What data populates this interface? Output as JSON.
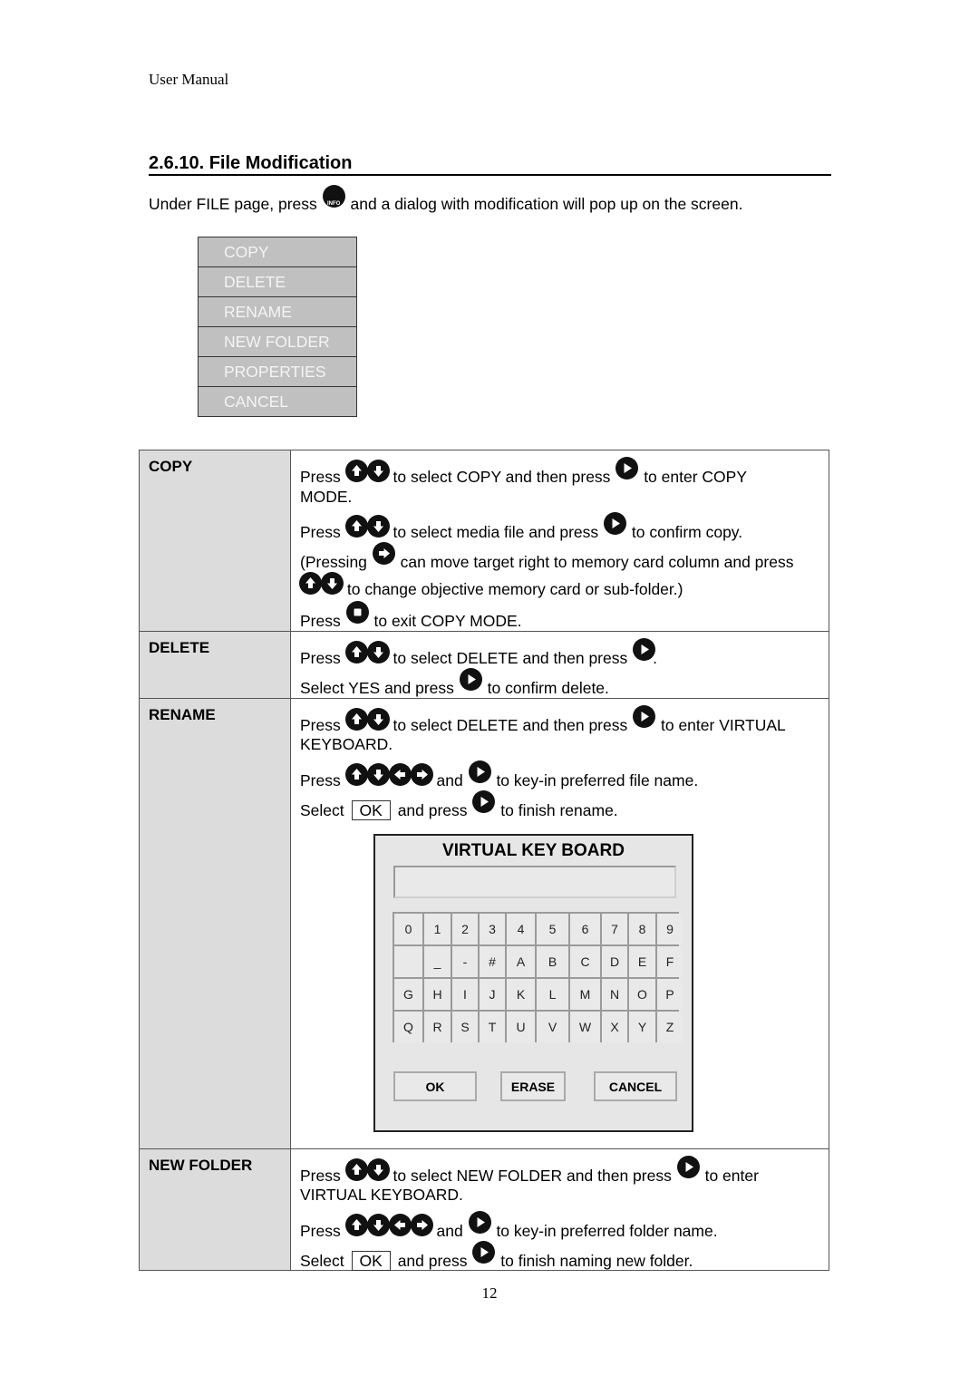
{
  "header": {
    "running_title": "User Manual"
  },
  "section": {
    "title": "2.6.10. File Modification",
    "intro_before": "Under FILE page, press",
    "intro_icon": "info-button",
    "intro_icon_label": "INFO",
    "intro_after": "and a dialog with modification will pop up on the screen."
  },
  "menu": {
    "items": [
      {
        "label": "COPY"
      },
      {
        "label": "DELETE"
      },
      {
        "label": "RENAME"
      },
      {
        "label": "NEW FOLDER"
      },
      {
        "label": "PROPERTIES"
      },
      {
        "label": "CANCEL"
      }
    ]
  },
  "table": {
    "rows": [
      {
        "header": "COPY",
        "lines": {
          "l1a": "Press",
          "l1b": "to select COPY and then press",
          "l1c": "to enter COPY",
          "l2": "MODE.",
          "l3a": "Press",
          "l3b": "to select media file and press",
          "l3c": "to confirm copy.",
          "l4a": "(Pressing",
          "l4b": "can move target right to memory card column and press",
          "l5": "to change objective memory card or sub-folder.)",
          "l6a": "Press",
          "l6b": "to exit COPY MODE."
        }
      },
      {
        "header": "DELETE",
        "lines": {
          "l1a": "Press",
          "l1b": "to select DELETE and then press",
          "l1c": ".",
          "l2a": "Select YES and press",
          "l2b": "to confirm delete."
        }
      },
      {
        "header": "RENAME",
        "lines": {
          "l1a": "Press",
          "l1b": "to select DELETE and then press",
          "l1c": "to enter VIRTUAL",
          "l2": "KEYBOARD.",
          "l3a": "Press",
          "l3b": "and",
          "l3c": "to key-in preferred file name.",
          "l4a": "Select",
          "l4ok": "OK",
          "l4b": "and press",
          "l4c": "to finish rename."
        }
      },
      {
        "header": "NEW FOLDER",
        "lines": {
          "l1a": "Press",
          "l1b": "to select NEW FOLDER and then press",
          "l1c": "to enter",
          "l2": "VIRTUAL KEYBOARD.",
          "l3a": "Press",
          "l3b": "and",
          "l3c": "to key-in preferred folder name.",
          "l4a": "Select",
          "l4ok": "OK",
          "l4b": "and press",
          "l4c": "to finish naming new folder."
        }
      }
    ]
  },
  "virtual_keyboard": {
    "title": "VIRTUAL KEY BOARD",
    "input_value": "",
    "keys": [
      "0",
      "1",
      "2",
      "3",
      "4",
      "5",
      "6",
      "7",
      "8",
      "9",
      "",
      "_",
      "-",
      "#",
      "A",
      "B",
      "C",
      "D",
      "E",
      "F",
      "G",
      "H",
      "I",
      "J",
      "K",
      "L",
      "M",
      "N",
      "O",
      "P",
      "Q",
      "R",
      "S",
      "T",
      "U",
      "V",
      "W",
      "X",
      "Y",
      "Z"
    ],
    "buttons": {
      "ok": "OK",
      "erase": "ERASE",
      "cancel": "CANCEL"
    }
  },
  "footer": {
    "page_number": "12"
  }
}
